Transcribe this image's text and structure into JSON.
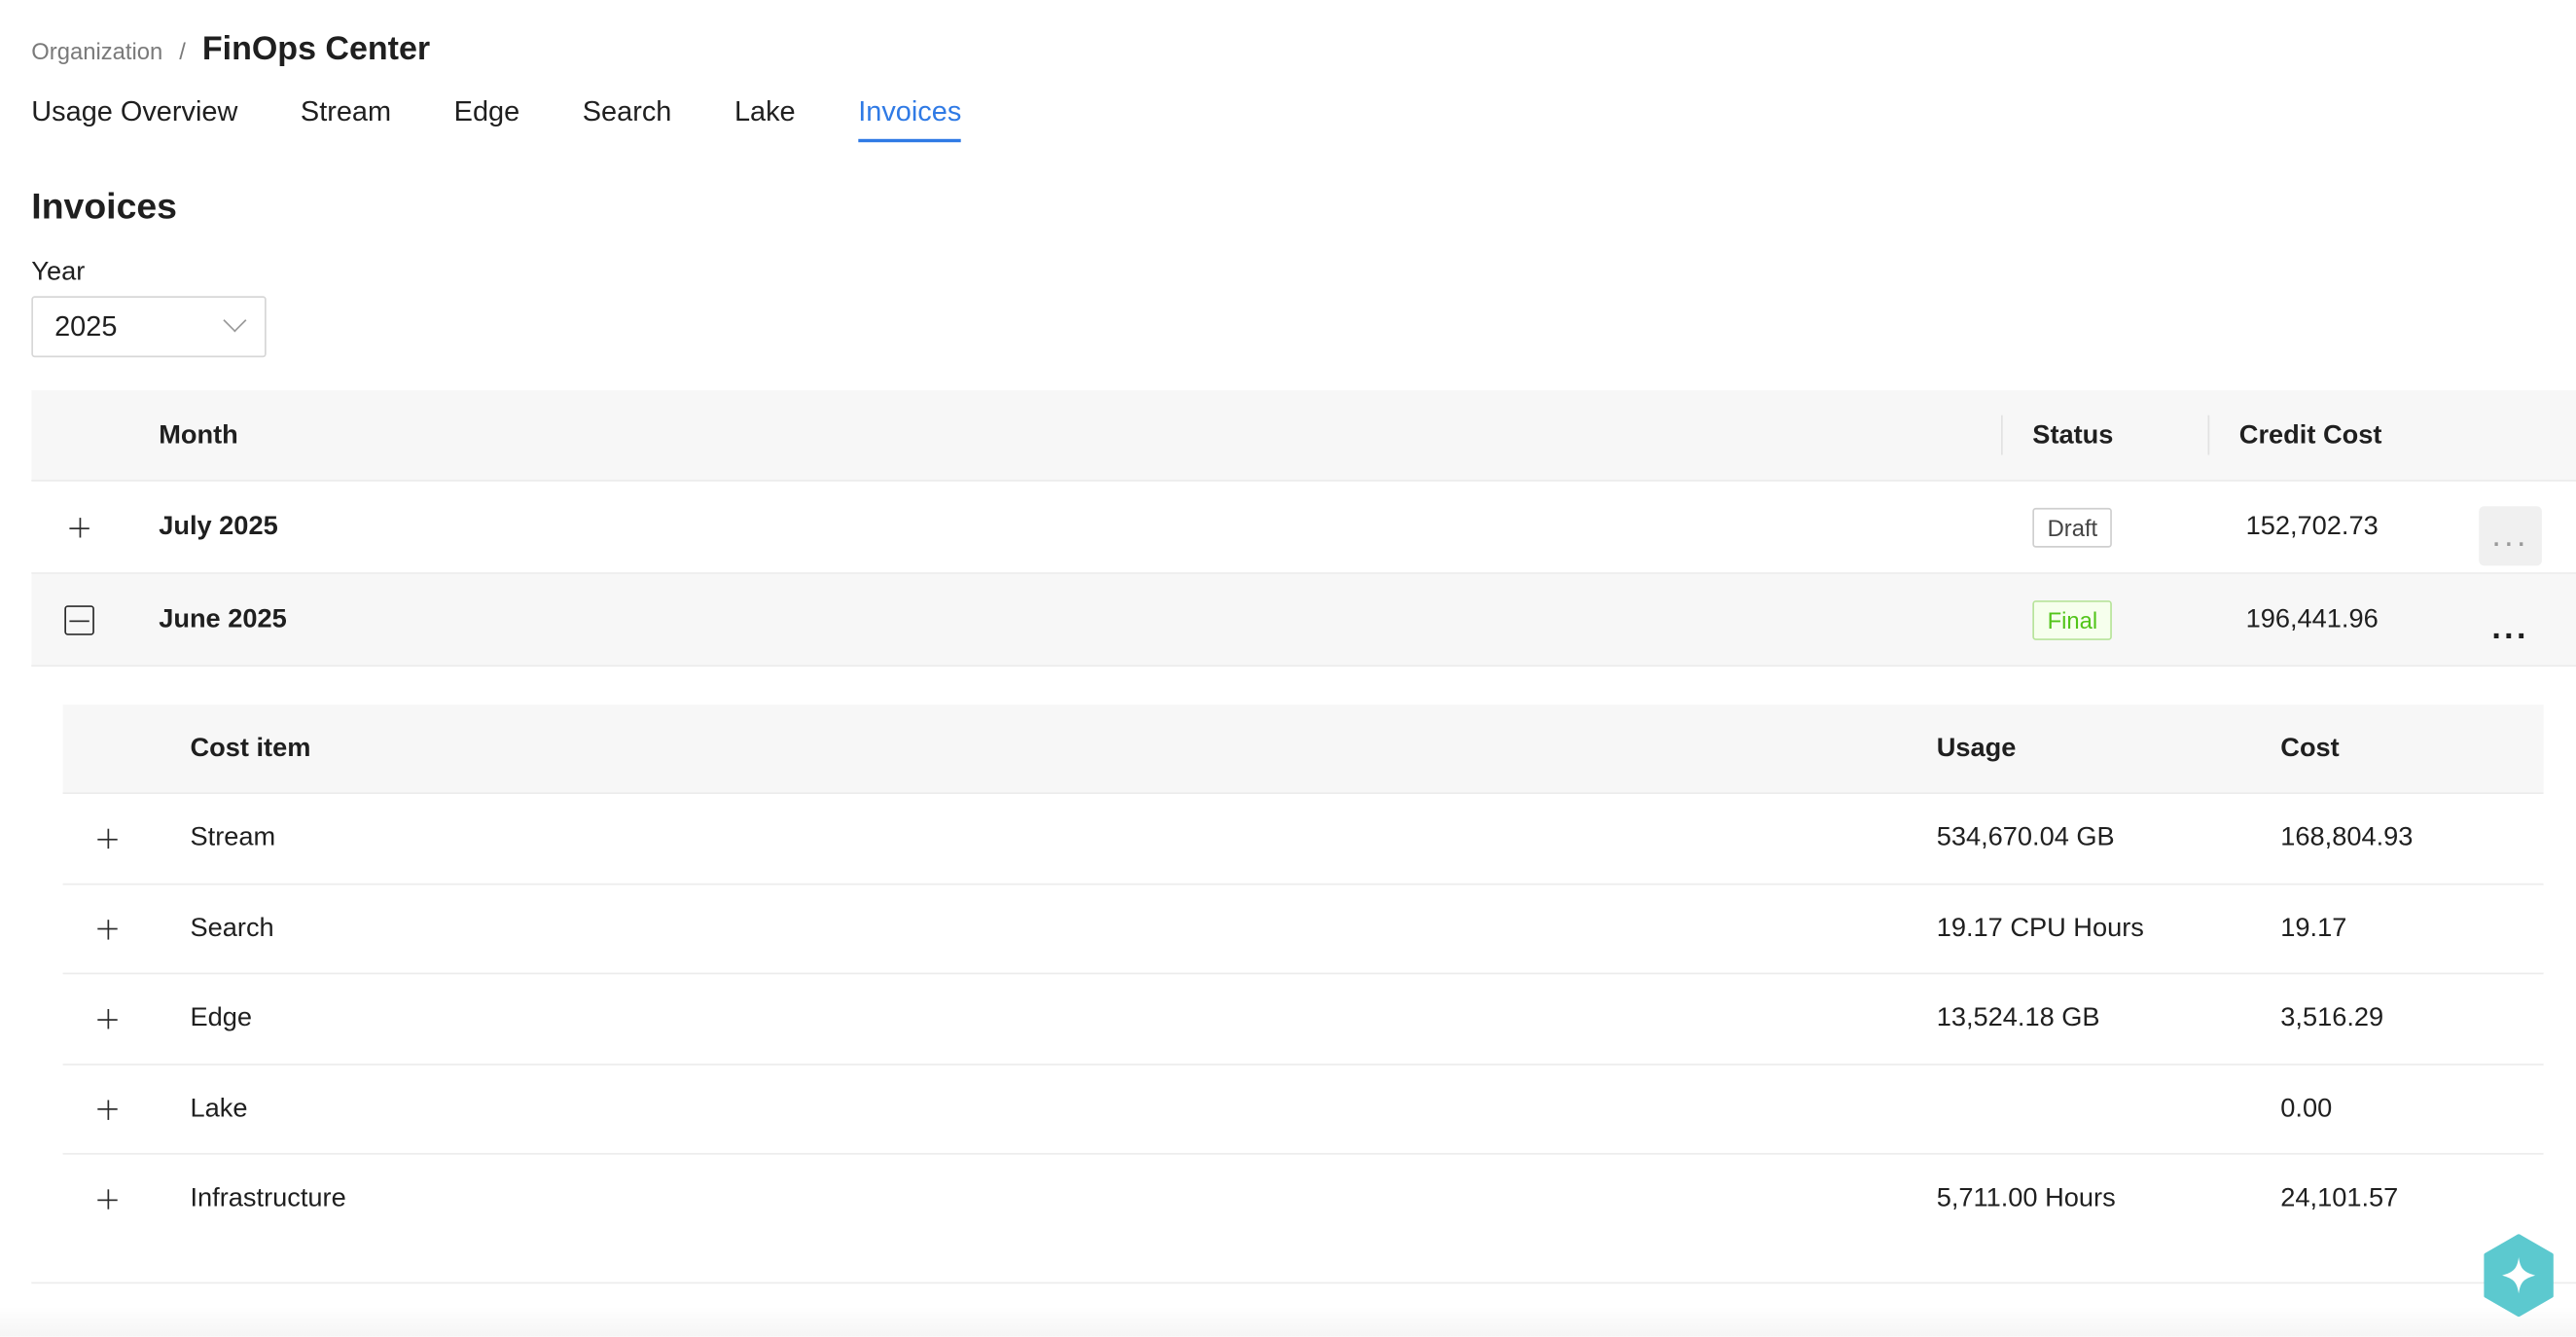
{
  "breadcrumb": {
    "parent": "Organization",
    "separator": "/",
    "current": "FinOps Center"
  },
  "tabs": [
    {
      "label": "Usage Overview",
      "active": false
    },
    {
      "label": "Stream",
      "active": false
    },
    {
      "label": "Edge",
      "active": false
    },
    {
      "label": "Search",
      "active": false
    },
    {
      "label": "Lake",
      "active": false
    },
    {
      "label": "Invoices",
      "active": true
    }
  ],
  "page": {
    "title": "Invoices",
    "year_label": "Year",
    "year_value": "2025"
  },
  "table": {
    "headers": {
      "month": "Month",
      "status": "Status",
      "credit_cost": "Credit Cost"
    },
    "rows": [
      {
        "month": "July 2025",
        "status": "Draft",
        "credit_cost": "152,702.73",
        "expanded": false
      },
      {
        "month": "June 2025",
        "status": "Final",
        "credit_cost": "196,441.96",
        "expanded": true
      }
    ],
    "more_label": "..."
  },
  "nested": {
    "headers": {
      "item": "Cost item",
      "usage": "Usage",
      "cost": "Cost"
    },
    "rows": [
      {
        "item": "Stream",
        "usage": "534,670.04 GB",
        "cost": "168,804.93"
      },
      {
        "item": "Search",
        "usage": "19.17 CPU Hours",
        "cost": "19.17"
      },
      {
        "item": "Edge",
        "usage": "13,524.18 GB",
        "cost": "3,516.29"
      },
      {
        "item": "Lake",
        "usage": "",
        "cost": "0.00"
      },
      {
        "item": "Infrastructure",
        "usage": "5,711.00 Hours",
        "cost": "24,101.57"
      }
    ]
  },
  "icons": {
    "fab": "sparkle-icon",
    "expand": "plus-icon",
    "collapse": "minus-icon",
    "more": "ellipsis-icon",
    "select": "chevron-down-icon"
  },
  "colors": {
    "accent": "#2f7ae5",
    "final_green": "#52c41a",
    "fab_teal": "#5cc9cf"
  }
}
